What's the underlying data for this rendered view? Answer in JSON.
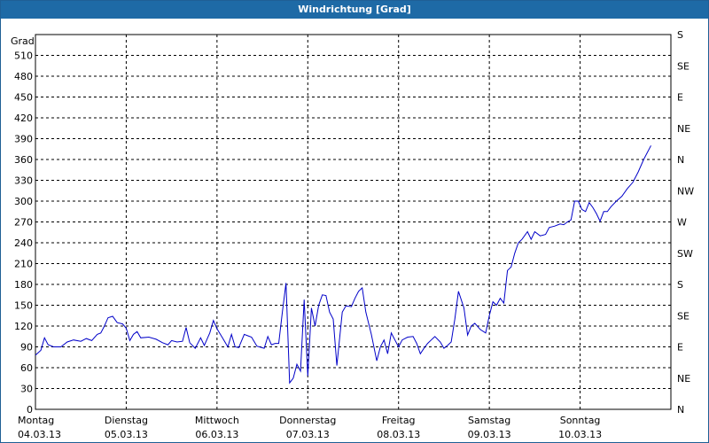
{
  "window": {
    "title": "Windrichtung [Grad]"
  },
  "chart_data": {
    "type": "line",
    "title": "Windrichtung [Grad]",
    "ylabel": "Grad",
    "ylim": [
      0,
      540
    ],
    "yticks": [
      0,
      30,
      60,
      90,
      120,
      150,
      180,
      210,
      240,
      270,
      300,
      330,
      360,
      390,
      420,
      450,
      480,
      510
    ],
    "right_axis_labels": [
      "N",
      "NE",
      "E",
      "SE",
      "S",
      "SW",
      "W",
      "NW",
      "N",
      "NE",
      "E",
      "SE",
      "S"
    ],
    "xlim": [
      0,
      7
    ],
    "x_unit": "days since Montag 04.03.13",
    "x_labels": [
      {
        "day": "Montag",
        "date": "04.03.13"
      },
      {
        "day": "Dienstag",
        "date": "05.03.13"
      },
      {
        "day": "Mittwoch",
        "date": "06.03.13"
      },
      {
        "day": "Donnerstag",
        "date": "07.03.13"
      },
      {
        "day": "Freitag",
        "date": "08.03.13"
      },
      {
        "day": "Samstag",
        "date": "09.03.13"
      },
      {
        "day": "Sonntag",
        "date": "10.03.13"
      }
    ],
    "grid": true,
    "line_color": "#0000c8",
    "series": [
      {
        "name": "Windrichtung",
        "points": [
          [
            0.0,
            78
          ],
          [
            0.06,
            85
          ],
          [
            0.1,
            103
          ],
          [
            0.14,
            93
          ],
          [
            0.2,
            90
          ],
          [
            0.28,
            90
          ],
          [
            0.35,
            97
          ],
          [
            0.42,
            100
          ],
          [
            0.5,
            98
          ],
          [
            0.56,
            102
          ],
          [
            0.62,
            99
          ],
          [
            0.68,
            108
          ],
          [
            0.72,
            110
          ],
          [
            0.76,
            120
          ],
          [
            0.8,
            132
          ],
          [
            0.85,
            134
          ],
          [
            0.9,
            125
          ],
          [
            0.96,
            123
          ],
          [
            1.0,
            117
          ],
          [
            1.04,
            99
          ],
          [
            1.08,
            108
          ],
          [
            1.12,
            112
          ],
          [
            1.16,
            103
          ],
          [
            1.25,
            104
          ],
          [
            1.33,
            101
          ],
          [
            1.4,
            96
          ],
          [
            1.46,
            93
          ],
          [
            1.5,
            99
          ],
          [
            1.56,
            97
          ],
          [
            1.62,
            98
          ],
          [
            1.66,
            118
          ],
          [
            1.7,
            96
          ],
          [
            1.76,
            88
          ],
          [
            1.82,
            103
          ],
          [
            1.86,
            92
          ],
          [
            1.92,
            110
          ],
          [
            1.96,
            128
          ],
          [
            2.0,
            116
          ],
          [
            2.06,
            103
          ],
          [
            2.12,
            90
          ],
          [
            2.16,
            108
          ],
          [
            2.2,
            90
          ],
          [
            2.24,
            89
          ],
          [
            2.3,
            108
          ],
          [
            2.34,
            106
          ],
          [
            2.38,
            104
          ],
          [
            2.44,
            91
          ],
          [
            2.52,
            88
          ],
          [
            2.56,
            105
          ],
          [
            2.6,
            93
          ],
          [
            2.64,
            95
          ],
          [
            2.68,
            95
          ],
          [
            2.72,
            140
          ],
          [
            2.76,
            182
          ],
          [
            2.8,
            38
          ],
          [
            2.84,
            45
          ],
          [
            2.88,
            65
          ],
          [
            2.92,
            55
          ],
          [
            2.96,
            158
          ],
          [
            3.0,
            48
          ],
          [
            3.04,
            146
          ],
          [
            3.08,
            120
          ],
          [
            3.12,
            150
          ],
          [
            3.16,
            165
          ],
          [
            3.2,
            164
          ],
          [
            3.24,
            140
          ],
          [
            3.28,
            130
          ],
          [
            3.32,
            63
          ],
          [
            3.38,
            140
          ],
          [
            3.42,
            149
          ],
          [
            3.48,
            148
          ],
          [
            3.52,
            160
          ],
          [
            3.56,
            170
          ],
          [
            3.6,
            175
          ],
          [
            3.64,
            140
          ],
          [
            3.7,
            108
          ],
          [
            3.76,
            70
          ],
          [
            3.8,
            90
          ],
          [
            3.84,
            100
          ],
          [
            3.88,
            80
          ],
          [
            3.92,
            110
          ],
          [
            3.96,
            100
          ],
          [
            4.0,
            90
          ],
          [
            4.04,
            100
          ],
          [
            4.1,
            104
          ],
          [
            4.16,
            105
          ],
          [
            4.2,
            95
          ],
          [
            4.24,
            80
          ],
          [
            4.28,
            88
          ],
          [
            4.32,
            95
          ],
          [
            4.36,
            100
          ],
          [
            4.4,
            105
          ],
          [
            4.46,
            97
          ],
          [
            4.5,
            88
          ],
          [
            4.54,
            92
          ],
          [
            4.58,
            97
          ],
          [
            4.62,
            130
          ],
          [
            4.66,
            170
          ],
          [
            4.72,
            146
          ],
          [
            4.76,
            107
          ],
          [
            4.8,
            120
          ],
          [
            4.84,
            124
          ],
          [
            4.9,
            115
          ],
          [
            4.96,
            110
          ],
          [
            5.0,
            135
          ],
          [
            5.04,
            155
          ],
          [
            5.08,
            150
          ],
          [
            5.12,
            160
          ],
          [
            5.16,
            153
          ],
          [
            5.2,
            200
          ],
          [
            5.24,
            205
          ],
          [
            5.28,
            225
          ],
          [
            5.32,
            240
          ],
          [
            5.36,
            245
          ],
          [
            5.42,
            256
          ],
          [
            5.46,
            245
          ],
          [
            5.5,
            256
          ],
          [
            5.56,
            250
          ],
          [
            5.62,
            252
          ],
          [
            5.66,
            262
          ],
          [
            5.72,
            264
          ],
          [
            5.78,
            267
          ],
          [
            5.82,
            266
          ],
          [
            5.86,
            270
          ],
          [
            5.9,
            273
          ],
          [
            5.94,
            300
          ],
          [
            5.98,
            300
          ],
          [
            6.02,
            288
          ],
          [
            6.06,
            285
          ],
          [
            6.1,
            298
          ],
          [
            6.14,
            291
          ],
          [
            6.18,
            282
          ],
          [
            6.22,
            271
          ],
          [
            6.26,
            285
          ],
          [
            6.3,
            285
          ],
          [
            6.34,
            292
          ],
          [
            6.4,
            300
          ],
          [
            6.46,
            307
          ],
          [
            6.52,
            318
          ],
          [
            6.58,
            327
          ],
          [
            6.64,
            342
          ],
          [
            6.7,
            360
          ],
          [
            6.78,
            380
          ]
        ]
      }
    ]
  }
}
